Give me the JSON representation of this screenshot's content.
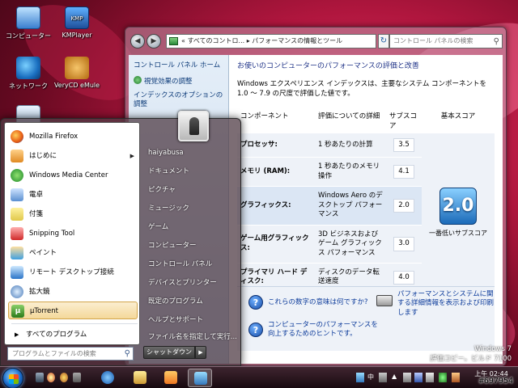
{
  "desktop": {
    "icons": [
      {
        "label": "コンピューター",
        "icon": "computer-icon"
      },
      {
        "label": "KMPlayer",
        "icon": "kmplayer-icon",
        "glyph": "KMP"
      },
      {
        "label": "ネットワーク",
        "icon": "network-icon"
      },
      {
        "label": "VeryCD eMule",
        "icon": "emule-icon"
      }
    ],
    "windows_brand": "Windows 7",
    "copy_note": "評価コピー。ビルド 7100"
  },
  "control_panel": {
    "address": "« すべてのコントロ... ▸ パフォーマンスの情報とツール",
    "search_placeholder": "コントロール パネルの検索",
    "left_links": [
      "コントロール パネル ホーム",
      "視覚効果の調整",
      "インデックスのオプションの調整"
    ],
    "heading": "お使いのコンピューターのパフォーマンスの評価と改善",
    "intro": "Windows エクスペリエンス インデックスは、主要なシステム コンポーネントを 1.0 ～ 7.9 の尺度で評価した値です。",
    "columns": {
      "component": "コンポーネント",
      "rating": "評価についての詳細",
      "subscore": "サブスコア",
      "basescore": "基本スコア"
    },
    "rows": [
      {
        "component": "プロセッサ:",
        "detail": "1 秒あたりの計算",
        "subscore": "3.5"
      },
      {
        "component": "メモリ (RAM):",
        "detail": "1 秒あたりのメモリ操作",
        "subscore": "4.1"
      },
      {
        "component": "グラフィックス:",
        "detail": "Windows Aero のデスクトップ パフォーマンス",
        "subscore": "2.0"
      },
      {
        "component": "ゲーム用グラフィックス:",
        "detail": "3D ビジネスおよびゲーム グラフィックス パフォーマンス",
        "subscore": "3.0"
      },
      {
        "component": "プライマリ ハード ディスク:",
        "detail": "ディスクのデータ転送速度",
        "subscore": "4.0"
      }
    ],
    "base_score": "2.0",
    "base_caption": "一番低いサブスコア",
    "help_links": [
      "これらの数字の意味は何ですか?",
      "コンピューターのパフォーマンスを向上するためのヒントです。",
      "パフォーマンスとシステムに関する詳細情報を表示および印刷します"
    ]
  },
  "start_menu": {
    "programs": [
      {
        "label": "Mozilla Firefox",
        "icon": "firefox-icon"
      },
      {
        "label": "はじめに",
        "icon": "getting-started-icon",
        "submenu": true
      },
      {
        "label": "Windows Media Center",
        "icon": "media-center-icon"
      },
      {
        "label": "電卓",
        "icon": "calculator-icon"
      },
      {
        "label": "付箋",
        "icon": "sticky-notes-icon"
      },
      {
        "label": "Snipping Tool",
        "icon": "snipping-tool-icon"
      },
      {
        "label": "ペイント",
        "icon": "paint-icon"
      },
      {
        "label": "リモート デスクトップ接続",
        "icon": "remote-desktop-icon"
      },
      {
        "label": "拡大鏡",
        "icon": "magnifier-icon"
      },
      {
        "label": "µTorrent",
        "icon": "utorrent-icon",
        "glyph": "µ",
        "selected": true
      }
    ],
    "all_programs": "すべてのプログラム",
    "search_placeholder": "プログラムとファイルの検索",
    "right_items": [
      "haiyabusa",
      "ドキュメント",
      "ピクチャ",
      "ミュージック",
      "ゲーム",
      "コンピューター",
      "コントロール パネル",
      "デバイスとプリンター",
      "既定のプログラム",
      "ヘルプとサポート",
      "ファイル名を指定して実行..."
    ],
    "shutdown_label": "シャットダウン"
  },
  "taskbar": {
    "tray_ime": "中",
    "clock_period": "上午",
    "clock_time": "02:44",
    "watermark": "#697954"
  }
}
